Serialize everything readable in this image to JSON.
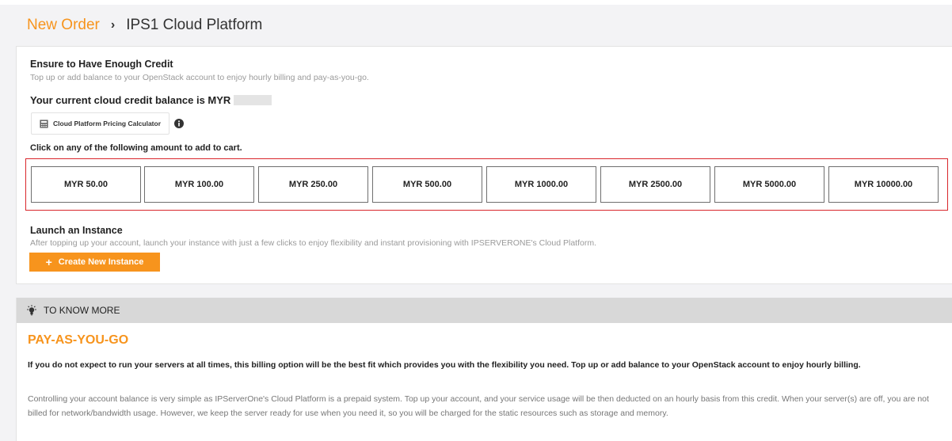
{
  "breadcrumb": {
    "parent": "New Order",
    "separator": "›",
    "current": "IPS1 Cloud Platform"
  },
  "credit": {
    "heading": "Ensure to Have Enough Credit",
    "subtext": "Top up or add balance to your OpenStack account to enjoy hourly billing and pay-as-you-go.",
    "balance_text": "Your current cloud credit balance is MYR",
    "calculator_label": "Cloud Platform Pricing Calculator",
    "click_label": "Click on any of the following amount to add to cart."
  },
  "amounts": [
    "MYR 50.00",
    "MYR 100.00",
    "MYR 250.00",
    "MYR 500.00",
    "MYR 1000.00",
    "MYR 2500.00",
    "MYR 5000.00",
    "MYR 10000.00"
  ],
  "launch": {
    "heading": "Launch an Instance",
    "subtext": "After topping up your account, launch your instance with just a few clicks to enjoy flexibility and instant provisioning with IPSERVERONE's Cloud Platform.",
    "button_label": "Create New Instance"
  },
  "know_more": {
    "header": "TO KNOW MORE",
    "title": "PAY-AS-YOU-GO",
    "bold_text": "If you do not expect to run your servers at all times, this billing option will be the best fit which provides you with the flexibility you need. Top up or add balance to your OpenStack account to enjoy hourly billing.",
    "body_text": "Controlling your account balance is very simple as IPServerOne's Cloud Platform is a prepaid system. Top up your account, and your service usage will be then deducted on an hourly basis from this credit. When your server(s) are off, you are not billed for network/bandwidth usage. However, we keep the server ready for use when you need it, so you will be charged for the static resources such as storage and memory."
  },
  "colors": {
    "accent": "#f7941d",
    "highlight_border": "#d9262b"
  },
  "icons": {
    "calculator": "calculator-icon",
    "info": "info-icon",
    "bulb": "lightbulb-icon"
  }
}
